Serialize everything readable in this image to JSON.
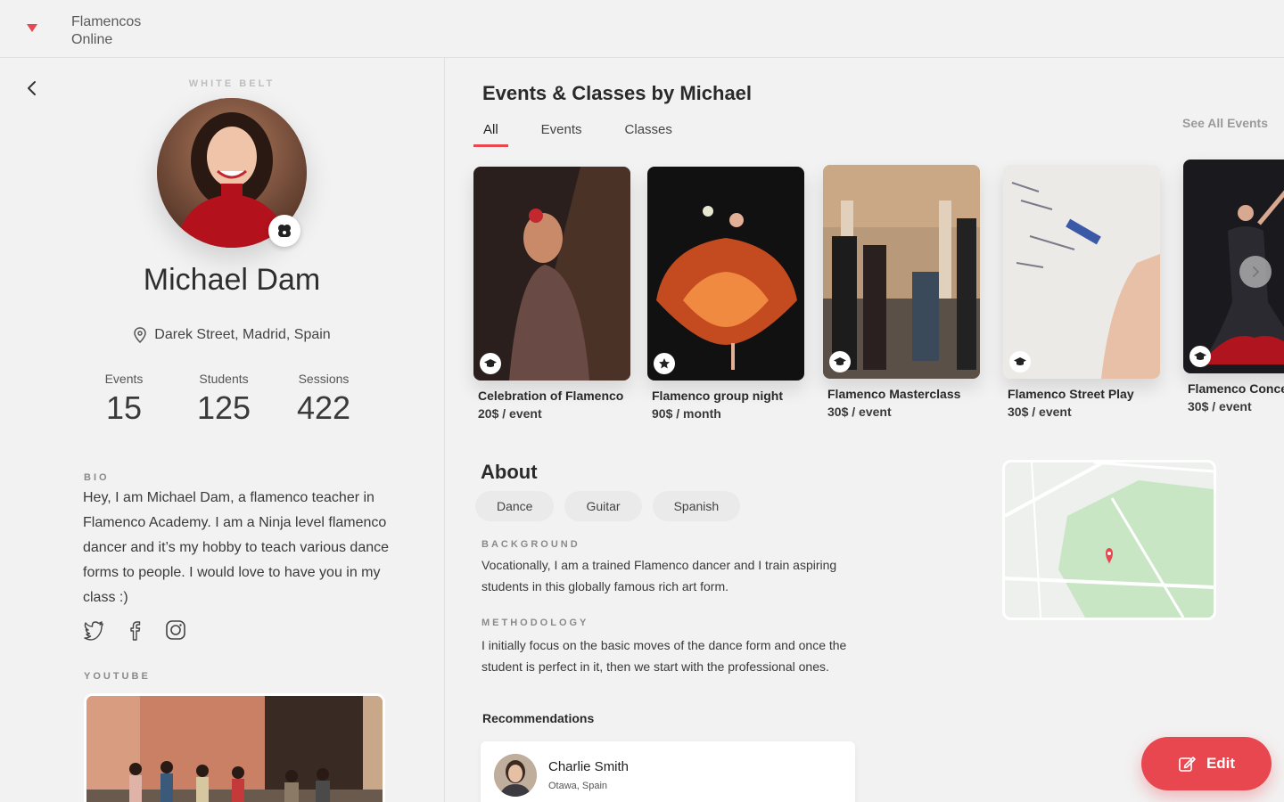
{
  "app": {
    "name_line1": "Flamencos",
    "name_line2": "Online"
  },
  "profile": {
    "belt": "WHITE BELT",
    "name": "Michael Dam",
    "location": "Darek Street, Madrid, Spain",
    "stats": [
      {
        "label": "Events",
        "value": "15"
      },
      {
        "label": "Students",
        "value": "125"
      },
      {
        "label": "Sessions",
        "value": "422"
      }
    ],
    "bio_label": "BIO",
    "bio": "Hey, I am Michael Dam, a flamenco teacher in Flamenco Academy. I am a Ninja level flamenco dancer and it’s my hobby to teach various dance forms to people. I would love to have you in my class :)",
    "socials": [
      "twitter-icon",
      "facebook-icon",
      "instagram-icon"
    ],
    "youtube_label": "YOUTUBE"
  },
  "events": {
    "title": "Events & Classes by Michael",
    "tabs": [
      "All",
      "Events",
      "Classes"
    ],
    "active_tab": "All",
    "see_all": "See All Events",
    "cards": [
      {
        "title": "Celebration of Flamenco",
        "price": "20$ / event",
        "icon": "graduation-cap-icon"
      },
      {
        "title": "Flamenco group night",
        "price": "90$ / month",
        "icon": "star-icon"
      },
      {
        "title": "Flamenco Masterclass",
        "price": "30$ / event",
        "icon": "graduation-cap-icon"
      },
      {
        "title": "Flamenco Street Play",
        "price": "30$ / event",
        "icon": "graduation-cap-icon"
      },
      {
        "title": "Flamenco Concer",
        "price": "30$ / event",
        "icon": "graduation-cap-icon"
      }
    ]
  },
  "about": {
    "title": "About",
    "chips": [
      "Dance",
      "Guitar",
      "Spanish"
    ],
    "background_label": "BACKGROUND",
    "background": "Vocationally, I am a trained Flamenco dancer and I train aspiring students in this globally famous rich art form.",
    "methodology_label": "METHODOLOGY",
    "methodology": "I initially focus on the basic moves of the dance form and once the student is perfect in it, then we start with the professional ones."
  },
  "recommendations": {
    "title": "Recommendations",
    "items": [
      {
        "name": "Charlie Smith",
        "location": "Otawa, Spain"
      }
    ]
  },
  "actions": {
    "edit": "Edit"
  },
  "colors": {
    "accent": "#e8474f",
    "background": "#f2f2f2"
  }
}
